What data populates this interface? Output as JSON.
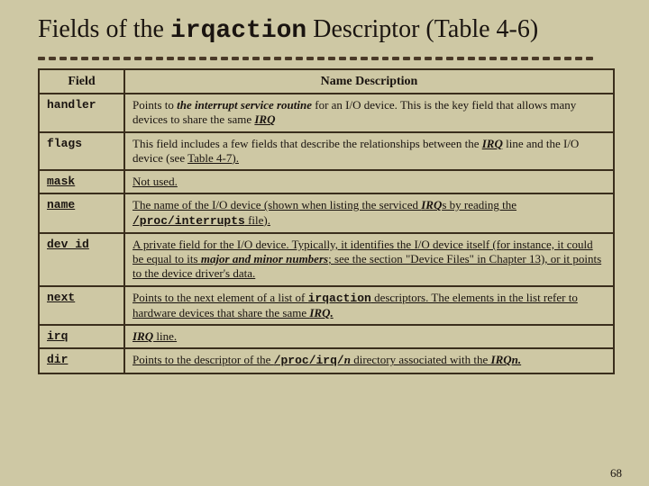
{
  "title_pre": "Fields of the ",
  "title_code": "irqaction",
  "title_post": " Descriptor (Table 4-6)",
  "header_field": "Field",
  "header_desc": "Name Description",
  "rows": {
    "r0": {
      "name": "handler",
      "d1": "Points to ",
      "d2": "the interrupt service routine",
      "d3": " for an I/O device. This is the key field that allows many devices to share the same ",
      "d4": "IRQ"
    },
    "r1": {
      "name": "flags",
      "d1": "This field includes a few fields that describe the relationships between the ",
      "d2": "IRQ",
      "d3": " line and the I/O device (see ",
      "d4": "Table 4-7).",
      "d5": ""
    },
    "r2": {
      "name": "mask",
      "d1": "Not used."
    },
    "r3": {
      "name": "name",
      "d1": "The name of the I/O device (shown when listing the serviced ",
      "d2": "IRQ",
      "d3": "s by reading the ",
      "d4": "/proc/interrupts",
      "d5": " file)."
    },
    "r4": {
      "name": "dev_id",
      "d1": "A private field for the I/O device. Typically, it identifies the I/O device itself (for instance, it could be equal to its ",
      "d2": "major and minor numbers",
      "d3": "; see the section \"Device Files\" in Chapter 13), or it points to the device driver's data."
    },
    "r5": {
      "name": "next",
      "d1": "Points to the next element of a list of ",
      "d2": "irqaction",
      "d3": " descriptors. The elements in the list refer to hardware devices that share the same ",
      "d4": "IRQ.",
      "d5": ""
    },
    "r6": {
      "name": "irq",
      "d1": "IRQ",
      "d2": " line."
    },
    "r7": {
      "name": "dir",
      "d1": "Points to the descriptor of the ",
      "d2": "/proc/irq/",
      "d3": "n",
      "d4": " directory associated with the ",
      "d5": "IRQn."
    }
  },
  "page_number": "68"
}
